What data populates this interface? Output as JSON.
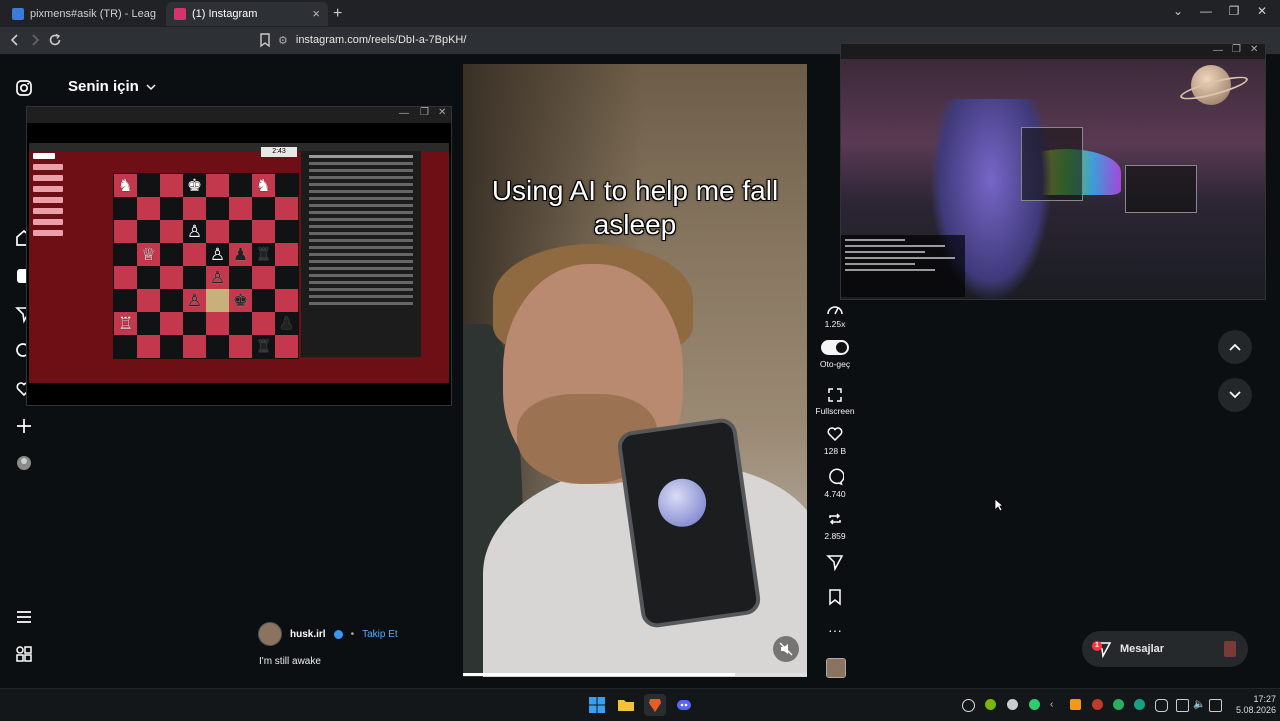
{
  "browser": {
    "tabs": [
      {
        "title": "pixmens#asik (TR) - LeagueOfGraphs",
        "active": false,
        "favicon_color": "#3b7bd9"
      },
      {
        "title": "(1) Instagram",
        "active": true,
        "favicon_color": "#d6336c"
      }
    ],
    "url": "instagram.com/reels/DbI-a-7BpKH/"
  },
  "instagram": {
    "feed_title": "Senin için",
    "author": {
      "username": "husk.irl",
      "follow_label": "Takip Et",
      "separator": "•"
    },
    "reel_description": "I'm still awake",
    "reel_caption": "Using AI to help me fall asleep",
    "progress_fraction": 0.79,
    "actions": {
      "speed": "1.25x",
      "autoscroll_label": "Oto-geç",
      "fullscreen_label": "Fullscreen",
      "likes": "128 B",
      "comments": "4.740",
      "reposts": "2.859"
    },
    "messages_label": "Mesajlar",
    "messages_badge": "1"
  },
  "chess_window": {
    "timer": "2:43"
  },
  "taskbar": {
    "time": "17:27",
    "date": "5.08.2026"
  },
  "colors": {
    "accent_link": "#5aa7ff",
    "verified": "#3897f0",
    "badge": "#ff3040",
    "chess_light": "#c4384d",
    "chess_dark": "#111214"
  }
}
